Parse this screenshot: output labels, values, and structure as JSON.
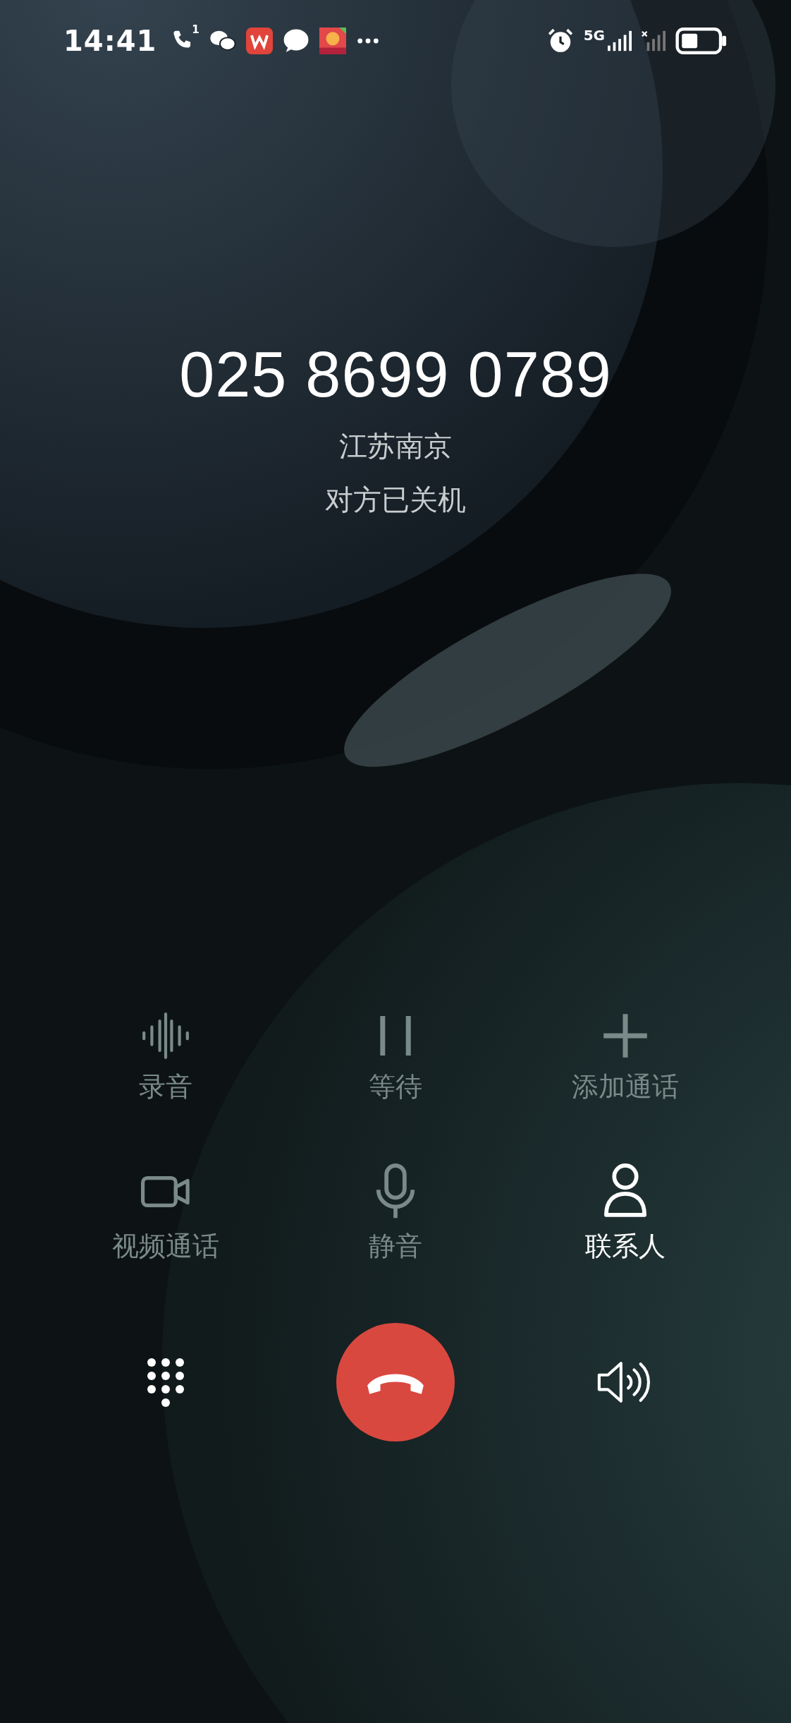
{
  "status_bar": {
    "time": "14:41",
    "call_badge": "1",
    "network": "5G"
  },
  "call": {
    "number": "025 8699 0789",
    "location": "江苏南京",
    "status": "对方已关机"
  },
  "controls": [
    {
      "kind": "record",
      "label": "录音",
      "disabled": true
    },
    {
      "kind": "hold",
      "label": "等待",
      "disabled": true
    },
    {
      "kind": "add",
      "label": "添加通话",
      "disabled": true
    },
    {
      "kind": "video",
      "label": "视频通话",
      "disabled": true
    },
    {
      "kind": "mute",
      "label": "静音",
      "disabled": true
    },
    {
      "kind": "contact",
      "label": "联系人",
      "disabled": false
    }
  ],
  "bottom": [
    {
      "kind": "keypad"
    },
    {
      "kind": "hangup"
    },
    {
      "kind": "speaker"
    }
  ]
}
